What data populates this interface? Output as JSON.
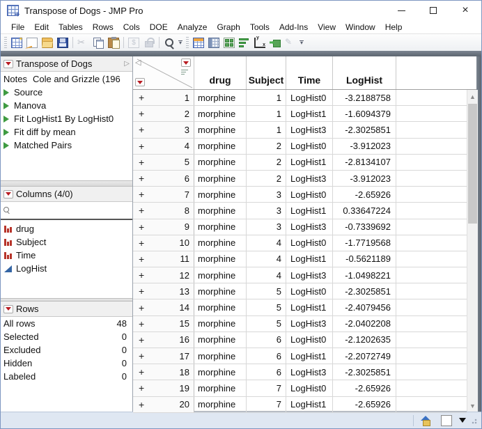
{
  "window": {
    "title": "Transpose of Dogs - JMP Pro"
  },
  "menu": {
    "items": [
      "File",
      "Edit",
      "Tables",
      "Rows",
      "Cols",
      "DOE",
      "Analyze",
      "Graph",
      "Tools",
      "Add-Ins",
      "View",
      "Window",
      "Help"
    ]
  },
  "sidebar": {
    "table_panel": {
      "title": "Transpose of Dogs",
      "notes_label": "Notes",
      "notes_value": "Cole and Grizzle (196",
      "items": [
        "Source",
        "Manova",
        "Fit LogHist1 By LogHist0",
        "Fit diff by mean",
        "Matched Pairs"
      ]
    },
    "columns_panel": {
      "title": "Columns (4/0)",
      "search_value": "",
      "columns": [
        {
          "name": "drug",
          "type": "nominal"
        },
        {
          "name": "Subject",
          "type": "nominal"
        },
        {
          "name": "Time",
          "type": "nominal"
        },
        {
          "name": "LogHist",
          "type": "continuous"
        }
      ]
    },
    "rows_panel": {
      "title": "Rows",
      "stats": [
        {
          "label": "All rows",
          "value": "48"
        },
        {
          "label": "Selected",
          "value": "0"
        },
        {
          "label": "Excluded",
          "value": "0"
        },
        {
          "label": "Hidden",
          "value": "0"
        },
        {
          "label": "Labeled",
          "value": "0"
        }
      ]
    }
  },
  "table": {
    "row_marker": "+",
    "headers": {
      "drug": "drug",
      "subject": "Subject",
      "time": "Time",
      "loghist": "LogHist"
    },
    "rows": [
      {
        "n": "1",
        "drug": "morphine",
        "subject": "1",
        "time": "LogHist0",
        "loghist": "-3.2188758"
      },
      {
        "n": "2",
        "drug": "morphine",
        "subject": "1",
        "time": "LogHist1",
        "loghist": "-1.6094379"
      },
      {
        "n": "3",
        "drug": "morphine",
        "subject": "1",
        "time": "LogHist3",
        "loghist": "-2.3025851"
      },
      {
        "n": "4",
        "drug": "morphine",
        "subject": "2",
        "time": "LogHist0",
        "loghist": "-3.912023"
      },
      {
        "n": "5",
        "drug": "morphine",
        "subject": "2",
        "time": "LogHist1",
        "loghist": "-2.8134107"
      },
      {
        "n": "6",
        "drug": "morphine",
        "subject": "2",
        "time": "LogHist3",
        "loghist": "-3.912023"
      },
      {
        "n": "7",
        "drug": "morphine",
        "subject": "3",
        "time": "LogHist0",
        "loghist": "-2.65926"
      },
      {
        "n": "8",
        "drug": "morphine",
        "subject": "3",
        "time": "LogHist1",
        "loghist": "0.33647224"
      },
      {
        "n": "9",
        "drug": "morphine",
        "subject": "3",
        "time": "LogHist3",
        "loghist": "-0.7339692"
      },
      {
        "n": "10",
        "drug": "morphine",
        "subject": "4",
        "time": "LogHist0",
        "loghist": "-1.7719568"
      },
      {
        "n": "11",
        "drug": "morphine",
        "subject": "4",
        "time": "LogHist1",
        "loghist": "-0.5621189"
      },
      {
        "n": "12",
        "drug": "morphine",
        "subject": "4",
        "time": "LogHist3",
        "loghist": "-1.0498221"
      },
      {
        "n": "13",
        "drug": "morphine",
        "subject": "5",
        "time": "LogHist0",
        "loghist": "-2.3025851"
      },
      {
        "n": "14",
        "drug": "morphine",
        "subject": "5",
        "time": "LogHist1",
        "loghist": "-2.4079456"
      },
      {
        "n": "15",
        "drug": "morphine",
        "subject": "5",
        "time": "LogHist3",
        "loghist": "-2.0402208"
      },
      {
        "n": "16",
        "drug": "morphine",
        "subject": "6",
        "time": "LogHist0",
        "loghist": "-2.1202635"
      },
      {
        "n": "17",
        "drug": "morphine",
        "subject": "6",
        "time": "LogHist1",
        "loghist": "-2.2072749"
      },
      {
        "n": "18",
        "drug": "morphine",
        "subject": "6",
        "time": "LogHist3",
        "loghist": "-2.3025851"
      },
      {
        "n": "19",
        "drug": "morphine",
        "subject": "7",
        "time": "LogHist0",
        "loghist": "-2.65926"
      },
      {
        "n": "20",
        "drug": "morphine",
        "subject": "7",
        "time": "LogHist1",
        "loghist": "-2.65926"
      }
    ]
  },
  "colors": {
    "red_triangle": "#b81c22",
    "green_disclosure": "#3f9b41",
    "nominal_icon": "#b7342a",
    "continuous_icon": "#3465a4",
    "statusbar_bg": "#dfe7f2",
    "dark_band": "#5d6670"
  }
}
